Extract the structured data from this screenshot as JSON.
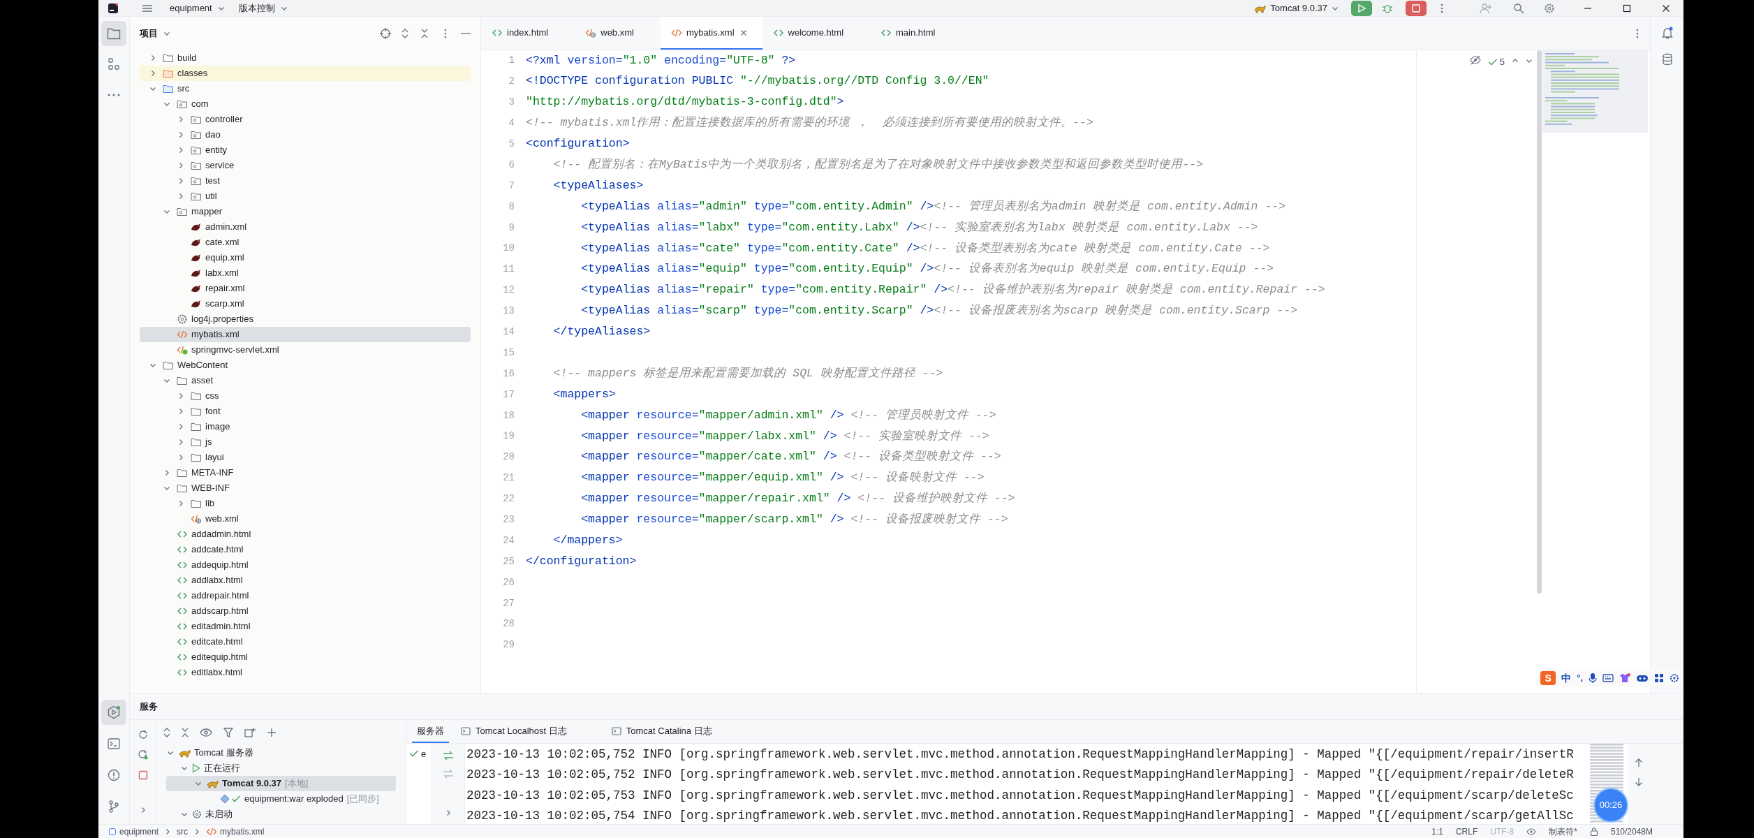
{
  "top_bar": {
    "project": "equipment",
    "vcs": "版本控制",
    "run_config": "Tomcat 9.0.37"
  },
  "project_panel": {
    "title": "项目",
    "tree": [
      {
        "label": "build",
        "kind": "folder",
        "expanded": false,
        "selected": false
      },
      {
        "label": "classes",
        "kind": "excluded-folder",
        "expanded": false,
        "selected": false
      },
      {
        "label": "src",
        "kind": "source-folder",
        "expanded": true,
        "selected": false,
        "children": [
          {
            "label": "com",
            "kind": "package",
            "expanded": true,
            "selected": false,
            "children": [
              {
                "label": "controller",
                "kind": "package",
                "expanded": false,
                "selected": false
              },
              {
                "label": "dao",
                "kind": "package",
                "expanded": false,
                "selected": false
              },
              {
                "label": "entity",
                "kind": "package",
                "expanded": false,
                "selected": false
              },
              {
                "label": "service",
                "kind": "package",
                "expanded": false,
                "selected": false
              },
              {
                "label": "test",
                "kind": "package",
                "expanded": false,
                "selected": false
              },
              {
                "label": "util",
                "kind": "package",
                "expanded": false,
                "selected": false
              }
            ]
          },
          {
            "label": "mapper",
            "kind": "package",
            "expanded": true,
            "selected": false,
            "children": [
              {
                "label": "admin.xml",
                "kind": "mybatis-xml",
                "selected": false
              },
              {
                "label": "cate.xml",
                "kind": "mybatis-xml",
                "selected": false
              },
              {
                "label": "equip.xml",
                "kind": "mybatis-xml",
                "selected": false
              },
              {
                "label": "labx.xml",
                "kind": "mybatis-xml",
                "selected": false
              },
              {
                "label": "repair.xml",
                "kind": "mybatis-xml",
                "selected": false
              },
              {
                "label": "scarp.xml",
                "kind": "mybatis-xml",
                "selected": false
              }
            ]
          },
          {
            "label": "log4j.properties",
            "kind": "properties",
            "selected": false
          },
          {
            "label": "mybatis.xml",
            "kind": "xml",
            "selected": true
          },
          {
            "label": "springmvc-servlet.xml",
            "kind": "spring-xml",
            "selected": false
          }
        ]
      },
      {
        "label": "WebContent",
        "kind": "folder",
        "expanded": true,
        "selected": false,
        "children": [
          {
            "label": "asset",
            "kind": "folder",
            "expanded": true,
            "selected": false,
            "children": [
              {
                "label": "css",
                "kind": "folder",
                "expanded": false,
                "selected": false
              },
              {
                "label": "font",
                "kind": "folder",
                "expanded": false,
                "selected": false
              },
              {
                "label": "image",
                "kind": "folder",
                "expanded": false,
                "selected": false
              },
              {
                "label": "js",
                "kind": "folder",
                "expanded": false,
                "selected": false
              },
              {
                "label": "layui",
                "kind": "folder",
                "expanded": false,
                "selected": false
              }
            ]
          },
          {
            "label": "META-INF",
            "kind": "folder",
            "expanded": false,
            "selected": false
          },
          {
            "label": "WEB-INF",
            "kind": "folder",
            "expanded": true,
            "selected": false,
            "children": [
              {
                "label": "lib",
                "kind": "folder",
                "expanded": false,
                "selected": false
              },
              {
                "label": "web.xml",
                "kind": "web-xml",
                "selected": false
              }
            ]
          },
          {
            "label": "addadmin.html",
            "kind": "html",
            "selected": false
          },
          {
            "label": "addcate.html",
            "kind": "html",
            "selected": false
          },
          {
            "label": "addequip.html",
            "kind": "html",
            "selected": false
          },
          {
            "label": "addlabx.html",
            "kind": "html",
            "selected": false
          },
          {
            "label": "addrepair.html",
            "kind": "html",
            "selected": false
          },
          {
            "label": "addscarp.html",
            "kind": "html",
            "selected": false
          },
          {
            "label": "editadmin.html",
            "kind": "html",
            "selected": false
          },
          {
            "label": "editcate.html",
            "kind": "html",
            "selected": false
          },
          {
            "label": "editequip.html",
            "kind": "html",
            "selected": false
          },
          {
            "label": "editlabx.html",
            "kind": "html",
            "selected": false
          }
        ]
      }
    ]
  },
  "editor": {
    "tabs": [
      {
        "label": "index.html",
        "kind": "html",
        "selected": false,
        "closable": false
      },
      {
        "label": "web.xml",
        "kind": "web-xml",
        "selected": false,
        "closable": false
      },
      {
        "label": "mybatis.xml",
        "kind": "xml",
        "selected": true,
        "closable": true
      },
      {
        "label": "welcome.html",
        "kind": "html",
        "selected": false,
        "closable": false
      },
      {
        "label": "main.html",
        "kind": "html",
        "selected": false,
        "closable": false
      }
    ],
    "inspection_count": "5",
    "lines": [
      {
        "number": "1",
        "code": "<?xml version=\"1.0\" encoding=\"UTF-8\" ?>"
      },
      {
        "number": "2",
        "code": "<!DOCTYPE configuration PUBLIC \"-//mybatis.org//DTD Config 3.0//EN\""
      },
      {
        "number": "3",
        "code": "\"http://mybatis.org/dtd/mybatis-3-config.dtd\">"
      },
      {
        "number": "4",
        "code": "<!-- mybatis.xml作用：配置连接数据库的所有需要的环境 ，  必须连接到所有要使用的映射文件。-->"
      },
      {
        "number": "5",
        "code": "<configuration>"
      },
      {
        "number": "6",
        "code": "    <!-- 配置别名：在MyBatis中为一个类取别名，配置别名是为了在对象映射文件中接收参数类型和返回参数类型时使用-->"
      },
      {
        "number": "7",
        "code": "    <typeAliases>"
      },
      {
        "number": "8",
        "code": "        <typeAlias alias=\"admin\" type=\"com.entity.Admin\" /><!-- 管理员表别名为admin 映射类是 com.entity.Admin -->"
      },
      {
        "number": "9",
        "code": "        <typeAlias alias=\"labx\" type=\"com.entity.Labx\" /><!-- 实验室表别名为labx 映射类是 com.entity.Labx -->"
      },
      {
        "number": "10",
        "code": "        <typeAlias alias=\"cate\" type=\"com.entity.Cate\" /><!-- 设备类型表别名为cate 映射类是 com.entity.Cate -->"
      },
      {
        "number": "11",
        "code": "        <typeAlias alias=\"equip\" type=\"com.entity.Equip\" /><!-- 设备表别名为equip 映射类是 com.entity.Equip -->"
      },
      {
        "number": "12",
        "code": "        <typeAlias alias=\"repair\" type=\"com.entity.Repair\" /><!-- 设备维护表别名为repair 映射类是 com.entity.Repair -->"
      },
      {
        "number": "13",
        "code": "        <typeAlias alias=\"scarp\" type=\"com.entity.Scarp\" /><!-- 设备报废表别名为scarp 映射类是 com.entity.Scarp -->"
      },
      {
        "number": "14",
        "code": "    </typeAliases>"
      },
      {
        "number": "15"
      },
      {
        "number": "16",
        "code": "    <!-- mappers 标签是用来配置需要加载的 SQL 映射配置文件路径 -->"
      },
      {
        "number": "17",
        "code": "    <mappers>"
      },
      {
        "number": "18",
        "code": "        <mapper resource=\"mapper/admin.xml\" /> <!-- 管理员映射文件 -->"
      },
      {
        "number": "19",
        "code": "        <mapper resource=\"mapper/labx.xml\" /> <!-- 实验室映射文件 -->"
      },
      {
        "number": "20",
        "code": "        <mapper resource=\"mapper/cate.xml\" /> <!-- 设备类型映射文件 -->"
      },
      {
        "number": "21",
        "code": "        <mapper resource=\"mapper/equip.xml\" /> <!-- 设备映射文件 -->"
      },
      {
        "number": "22",
        "code": "        <mapper resource=\"mapper/repair.xml\" /> <!-- 设备维护映射文件 -->"
      },
      {
        "number": "23",
        "code": "        <mapper resource=\"mapper/scarp.xml\" /> <!-- 设备报废映射文件 -->"
      },
      {
        "number": "24",
        "code": "    </mappers>"
      },
      {
        "number": "25",
        "code": "</configuration>"
      },
      {
        "number": "26"
      },
      {
        "number": "27"
      },
      {
        "number": "28"
      },
      {
        "number": "29"
      }
    ]
  },
  "services_panel": {
    "title": "服务",
    "tree": [
      {
        "label": "Tomcat 服务器",
        "kind": "server-group",
        "expanded": true,
        "selected": false,
        "children": [
          {
            "label": "正在运行",
            "kind": "running",
            "expanded": true,
            "selected": false,
            "children": [
              {
                "label": "Tomcat 9.0.37",
                "note": "[本地]",
                "kind": "server",
                "expanded": true,
                "selected": true,
                "children": [
                  {
                    "label": "equipment:war exploded",
                    "note": "[已同步]",
                    "kind": "artifact",
                    "selected": false
                  }
                ]
              }
            ]
          },
          {
            "label": "未启动",
            "kind": "not-started",
            "expanded": true,
            "selected": false
          }
        ]
      }
    ],
    "deployment": {
      "label": "e"
    },
    "tabs": [
      {
        "label": "服务器",
        "kind": "plain",
        "selected": true
      },
      {
        "label": "Tomcat Localhost 日志",
        "kind": "log",
        "selected": false
      },
      {
        "label": "Tomcat Catalina 日志",
        "kind": "log",
        "selected": false
      }
    ],
    "log_lines": [
      "2023-10-13 10:02:05,752 INFO [org.springframework.web.servlet.mvc.method.annotation.RequestMappingHandlerMapping] - Mapped \"{[/equipment/repair/insertR",
      "2023-10-13 10:02:05,752 INFO [org.springframework.web.servlet.mvc.method.annotation.RequestMappingHandlerMapping] - Mapped \"{[/equipment/repair/deleteR",
      "2023-10-13 10:02:05,753 INFO [org.springframework.web.servlet.mvc.method.annotation.RequestMappingHandlerMapping] - Mapped \"{[/equipment/scarp/deleteSc",
      "2023-10-13 10:02:05,754 INFO [org.springframework.web.servlet.mvc.method.annotation.RequestMappingHandlerMapping] - Mapped \"{[/equipment/scarp/getAllSc"
    ]
  },
  "status_bar": {
    "breadcrumb": [
      {
        "label": "equipment",
        "kind": "project"
      },
      {
        "label": "src",
        "kind": "plain"
      },
      {
        "label": "mybatis.xml",
        "kind": "xml"
      }
    ],
    "items": [
      {
        "label": "1:1",
        "dimmed": false
      },
      {
        "label": "CRLF",
        "dimmed": false
      },
      {
        "label": "UTF-8",
        "dimmed": true
      },
      {
        "label": "制表符*",
        "dimmed": false
      },
      {
        "label": "510/2048M",
        "dimmed": false
      }
    ]
  },
  "ime_toolbar": {
    "logo": "S",
    "mode": "中",
    "punctuation": "°,"
  },
  "recording_timer": "00:26"
}
